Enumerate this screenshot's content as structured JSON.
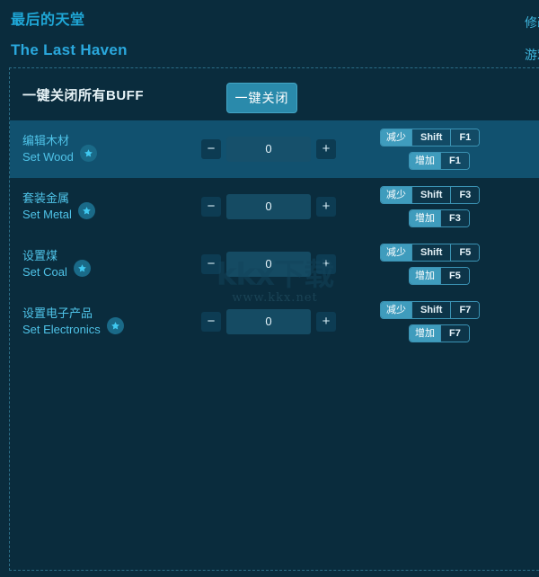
{
  "header": {
    "title_cn": "最后的天堂",
    "title_en": "The Last Haven"
  },
  "edge_nav": {
    "item1": "修改器",
    "item2": "游戏"
  },
  "buff": {
    "label": "一键关闭所有BUFF",
    "button_label": "一键关闭"
  },
  "stepper_icons": {
    "minus": "−",
    "plus": "+"
  },
  "rows": [
    {
      "label_cn": "编辑木材",
      "label_en": "Set Wood",
      "value": "0",
      "active": true,
      "decrease_label": "减少",
      "decrease_modifier": "Shift",
      "decrease_key": "F1",
      "increase_label": "增加",
      "increase_key": "F1"
    },
    {
      "label_cn": "套装金属",
      "label_en": "Set Metal",
      "value": "0",
      "active": false,
      "decrease_label": "减少",
      "decrease_modifier": "Shift",
      "decrease_key": "F3",
      "increase_label": "增加",
      "increase_key": "F3"
    },
    {
      "label_cn": "设置煤",
      "label_en": "Set Coal",
      "value": "0",
      "active": false,
      "decrease_label": "减少",
      "decrease_modifier": "Shift",
      "decrease_key": "F5",
      "increase_label": "增加",
      "increase_key": "F5"
    },
    {
      "label_cn": "设置电子产品",
      "label_en": "Set Electronics",
      "value": "0",
      "active": false,
      "decrease_label": "减少",
      "decrease_modifier": "Shift",
      "decrease_key": "F7",
      "increase_label": "增加",
      "increase_key": "F7"
    }
  ],
  "watermark": {
    "logo": "kkx下载",
    "url": "www.kkx.net"
  },
  "colors": {
    "background": "#0a2c3d",
    "row_active": "#11516f",
    "accent": "#2aa8dd",
    "button": "#2a8aab",
    "hotkey_action": "#3f9cbd",
    "label_text": "#4fc3e8"
  }
}
